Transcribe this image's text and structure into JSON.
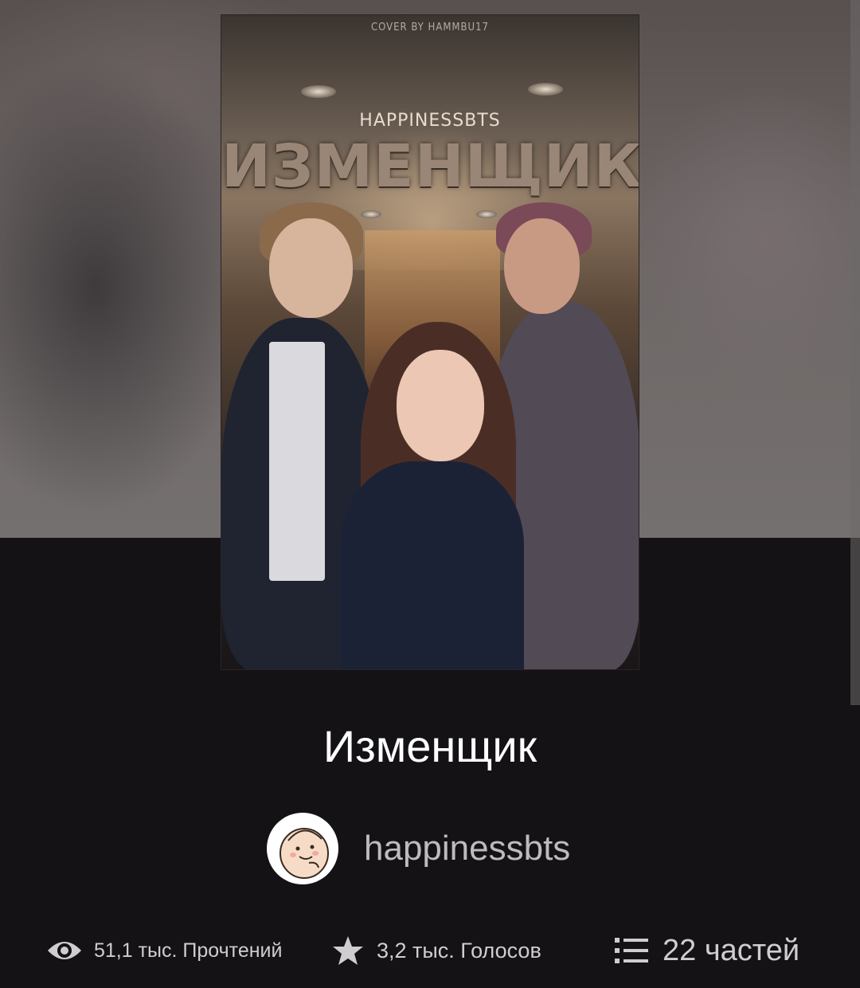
{
  "cover": {
    "credit": "COVER BY HAMMBU17",
    "author_text": "HAPPINESSBTS",
    "title_text": "ИЗМЕНЩИК"
  },
  "book": {
    "title": "Изменщик",
    "author": "happinessbts"
  },
  "stats": {
    "reads": "51,1 тыс. Прочтений",
    "votes": "3,2 тыс. Голосов",
    "parts": "22 частей"
  },
  "icons": {
    "reads": "eye-icon",
    "votes": "star-icon",
    "parts": "list-icon"
  },
  "colors": {
    "background": "#141215",
    "title_text": "#ffffff",
    "secondary_text": "#bdbbbd"
  }
}
